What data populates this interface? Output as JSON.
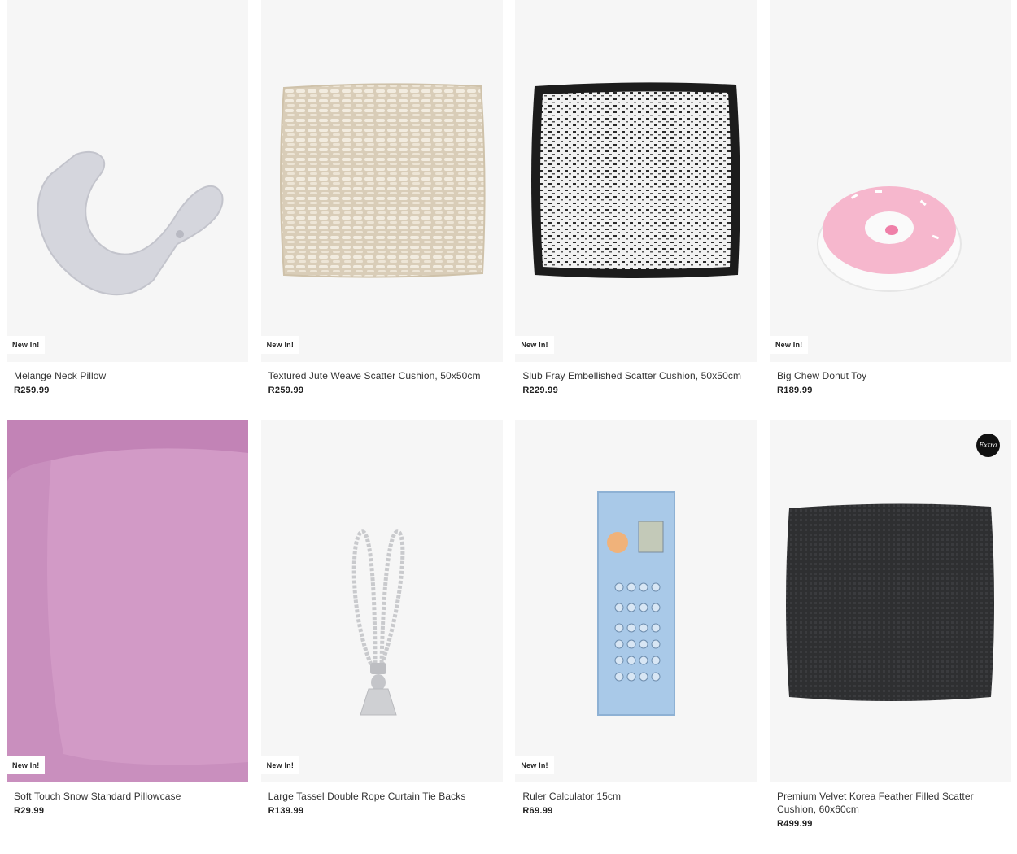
{
  "badge_label": "New In!",
  "extra_badge_label": "Extra",
  "products": [
    {
      "name": "Melange Neck Pillow",
      "price": "R259.99",
      "new": true
    },
    {
      "name": "Textured Jute Weave Scatter Cushion, 50x50cm",
      "price": "R259.99",
      "new": true
    },
    {
      "name": "Slub Fray Embellished Scatter Cushion, 50x50cm",
      "price": "R229.99",
      "new": true
    },
    {
      "name": "Big Chew Donut Toy",
      "price": "R189.99",
      "new": true
    },
    {
      "name": "Soft Touch Snow Standard Pillowcase",
      "price": "R29.99",
      "new": true
    },
    {
      "name": "Large Tassel Double Rope Curtain Tie Backs",
      "price": "R139.99",
      "new": true
    },
    {
      "name": "Ruler Calculator 15cm",
      "price": "R69.99",
      "new": true
    },
    {
      "name": "Premium Velvet Korea Feather Filled Scatter Cushion, 60x60cm",
      "price": "R499.99",
      "new": false,
      "extra": true
    }
  ],
  "colors": {
    "image_bg": "#f6f6f6",
    "pillowcase": "#c98fbe",
    "velvet": "#2e2f31",
    "calculator": "#a9c9e8"
  }
}
